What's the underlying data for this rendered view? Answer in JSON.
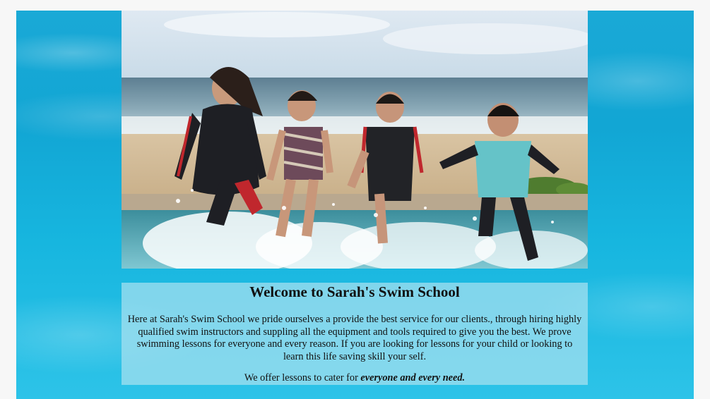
{
  "page": {
    "heading": "Welcome to Sarah's Swim School",
    "intro_line1": "Here at Sarah's Swim School we pride ourselves a provide the best service for our clients., through hiring highly qualified swim instructors and suppling all the equipment and tools required to give you the best.",
    "intro_line2": "We prove swimming lessons for everyone and every reason. If you are looking for lessons for your child or looking to learn this life saving skill your self.",
    "offer_prefix": "We offer lessons to cater for ",
    "offer_emphasis": "everyone and every need."
  },
  "colors": {
    "water": "#17b0dc",
    "panel": "#a8e0f0"
  },
  "images": {
    "background": "pool-water-background",
    "hero": "children-and-woman-splashing-at-poolside"
  }
}
